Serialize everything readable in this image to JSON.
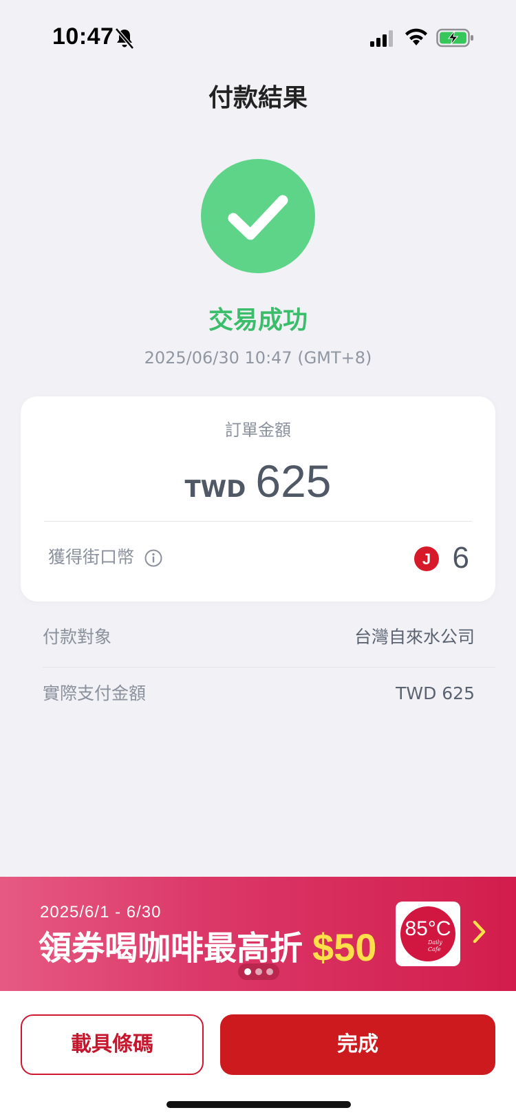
{
  "status_bar": {
    "time": "10:47",
    "icons": [
      "bell-slash-icon",
      "signal-icon",
      "wifi-icon",
      "battery-charging-icon"
    ]
  },
  "header": {
    "title": "付款結果"
  },
  "result": {
    "icon": "check-circle-icon",
    "status": "交易成功",
    "timestamp": "2025/06/30 10:47 (GMT+8)"
  },
  "amount_card": {
    "label": "訂單金額",
    "currency": "TWD",
    "amount": "625",
    "coin_label": "獲得街口幣",
    "coin_badge": "J",
    "coin_value": "6"
  },
  "details": [
    {
      "label": "付款對象",
      "value": "台灣自來水公司"
    },
    {
      "label": "實際支付金額",
      "value": "TWD 625"
    }
  ],
  "promo": {
    "date_range": "2025/6/1 - 6/30",
    "headline": "領券喝咖啡最高折",
    "amount": "$50",
    "logo_text": "85°C",
    "logo_subtext": "Daily Cafe",
    "page_count": 3,
    "active_page": 1
  },
  "actions": {
    "barcode_label": "載具條碼",
    "done_label": "完成"
  },
  "colors": {
    "success_green": "#5ed489",
    "brand_red": "#cc1a1f",
    "background": "#f2f2f6"
  }
}
